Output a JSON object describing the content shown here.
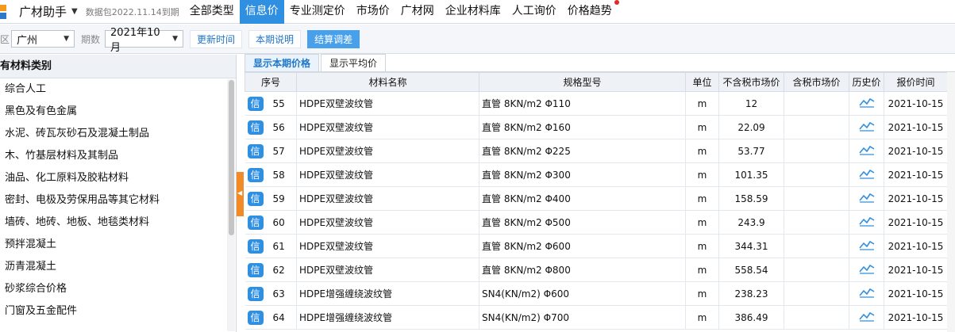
{
  "header": {
    "app_title": "广材助手",
    "data_package": "数据包2022.11.14到期",
    "tabs": [
      {
        "label": "全部类型",
        "active": false
      },
      {
        "label": "信息价",
        "active": true
      },
      {
        "label": "专业测定价",
        "active": false
      },
      {
        "label": "市场价",
        "active": false
      },
      {
        "label": "广材网",
        "active": false
      },
      {
        "label": "企业材料库",
        "active": false
      },
      {
        "label": "人工询价",
        "active": false
      },
      {
        "label": "价格趋势",
        "active": false
      }
    ]
  },
  "filters": {
    "region_label": "区",
    "region_value": "广州",
    "period_label": "期数",
    "period_value": "2021年10月",
    "update_time_label": "更新时间",
    "period_note_label": "本期说明",
    "settle_adjust_label": "结算调差"
  },
  "sidebar": {
    "header": "有材料类别",
    "items": [
      "综合人工",
      "黑色及有色金属",
      "水泥、砖瓦灰砂石及混凝土制品",
      "木、竹基层材料及其制品",
      "油品、化工原料及胶粘材料",
      "密封、电极及劳保用品等其它材料",
      "墙砖、地砖、地板、地毯类材料",
      "预拌混凝土",
      "沥青混凝土",
      "砂浆综合价格",
      "门窗及五金配件"
    ]
  },
  "main": {
    "subtabs": [
      "显示本期价格",
      "显示平均价"
    ],
    "columns": [
      "序号",
      "材料名称",
      "规格型号",
      "单位",
      "不含税市场价",
      "含税市场价",
      "历史价",
      "报价时间"
    ],
    "badge_label": "信",
    "rows": [
      {
        "seq": "55",
        "name": "HDPE双壁波纹管",
        "spec": "直管 8KN/m2 Φ110",
        "unit": "m",
        "price_ex_tax": "12",
        "price_inc_tax": "",
        "date": "2021-10-15"
      },
      {
        "seq": "56",
        "name": "HDPE双壁波纹管",
        "spec": "直管 8KN/m2 Φ160",
        "unit": "m",
        "price_ex_tax": "22.09",
        "price_inc_tax": "",
        "date": "2021-10-15"
      },
      {
        "seq": "57",
        "name": "HDPE双壁波纹管",
        "spec": "直管 8KN/m2 Φ225",
        "unit": "m",
        "price_ex_tax": "53.77",
        "price_inc_tax": "",
        "date": "2021-10-15"
      },
      {
        "seq": "58",
        "name": "HDPE双壁波纹管",
        "spec": "直管 8KN/m2 Φ300",
        "unit": "m",
        "price_ex_tax": "101.35",
        "price_inc_tax": "",
        "date": "2021-10-15"
      },
      {
        "seq": "59",
        "name": "HDPE双壁波纹管",
        "spec": "直管 8KN/m2 Φ400",
        "unit": "m",
        "price_ex_tax": "158.59",
        "price_inc_tax": "",
        "date": "2021-10-15"
      },
      {
        "seq": "60",
        "name": "HDPE双壁波纹管",
        "spec": "直管 8KN/m2 Φ500",
        "unit": "m",
        "price_ex_tax": "243.9",
        "price_inc_tax": "",
        "date": "2021-10-15"
      },
      {
        "seq": "61",
        "name": "HDPE双壁波纹管",
        "spec": "直管 8KN/m2 Φ600",
        "unit": "m",
        "price_ex_tax": "344.31",
        "price_inc_tax": "",
        "date": "2021-10-15"
      },
      {
        "seq": "62",
        "name": "HDPE双壁波纹管",
        "spec": "直管 8KN/m2 Φ800",
        "unit": "m",
        "price_ex_tax": "558.54",
        "price_inc_tax": "",
        "date": "2021-10-15"
      },
      {
        "seq": "63",
        "name": "HDPE增强缠绕波纹管",
        "spec": "SN4(KN/m2) Φ600",
        "unit": "m",
        "price_ex_tax": "238.23",
        "price_inc_tax": "",
        "date": "2021-10-15"
      },
      {
        "seq": "64",
        "name": "HDPE增强缠绕波纹管",
        "spec": "SN4(KN/m2) Φ700",
        "unit": "m",
        "price_ex_tax": "386.49",
        "price_inc_tax": "",
        "date": "2021-10-15"
      }
    ]
  },
  "colors": {
    "accent": "#2f8fe0",
    "handle": "#f28b25"
  }
}
